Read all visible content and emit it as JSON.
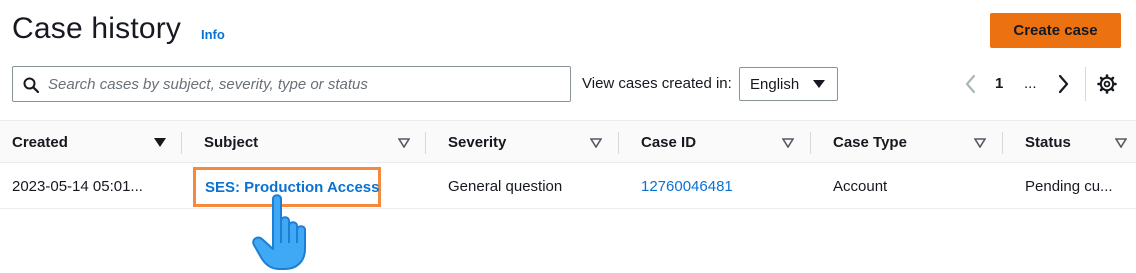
{
  "header": {
    "title": "Case history",
    "info_label": "Info",
    "create_button": "Create case"
  },
  "search": {
    "placeholder": "Search cases by subject, severity, type or status",
    "value": ""
  },
  "filter": {
    "label": "View cases created in:",
    "selected": "English"
  },
  "pagination": {
    "current_page": "1",
    "ellipsis": "..."
  },
  "table": {
    "columns": [
      "Created",
      "Subject",
      "Severity",
      "Case ID",
      "Case Type",
      "Status"
    ],
    "rows": [
      {
        "created": "2023-05-14 05:01...",
        "subject": "SES: Production Access",
        "severity": "General question",
        "case_id": "12760046481",
        "case_type": "Account",
        "status": "Pending cu..."
      }
    ]
  },
  "colors": {
    "accent": "#ec7211",
    "link": "#0972d3",
    "highlight_box": "#f58a3d",
    "cursor_fill": "#3fa9f5"
  },
  "icons": [
    "search-icon",
    "chevron-left-icon",
    "chevron-right-icon",
    "gear-icon",
    "sort-caret-icon",
    "hand-pointer-icon"
  ]
}
